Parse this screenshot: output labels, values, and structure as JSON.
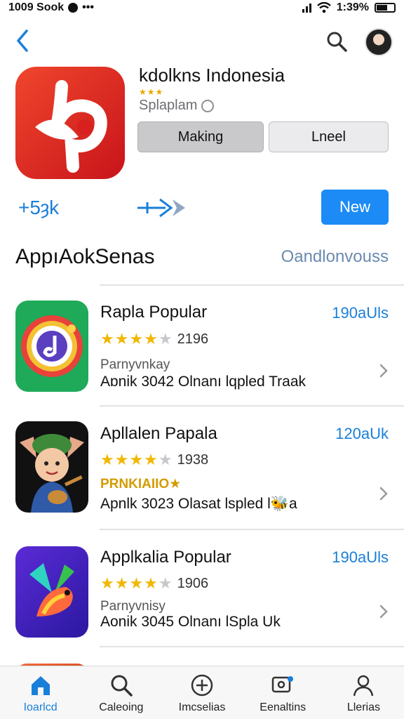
{
  "status": {
    "left_text": "1009 Sook",
    "right_text": "1:39%"
  },
  "app": {
    "title": "kdolkns Indonesia",
    "stars": "★★★",
    "subtitle": "Splaplam"
  },
  "buttons": {
    "making": "Making",
    "lneel": "Lneel",
    "new": "New"
  },
  "meta": {
    "left": "+5ȝk"
  },
  "section": {
    "title": "AppıAokSenas",
    "link": "Oandlonvouss"
  },
  "rows": [
    {
      "title": "Rapla Popular",
      "price": "190aUls",
      "rating_count": "2196",
      "stars_on": "★★★★",
      "star_off": "★",
      "sub": "Parnyvnkay",
      "detail": "Aɒnik 3042  Olnanı lqpled Traak"
    },
    {
      "title": "Apllalen Papala",
      "price": "120aUk",
      "rating_count": "1938",
      "stars_on": "★★★★",
      "star_off": "★",
      "sub": "PRNKIAIIO★",
      "detail": "Apnlk 3023  Olasat lspled l🐝a"
    },
    {
      "title": "Applkalia Popular",
      "price": "190aUls",
      "rating_count": "1906",
      "stars_on": "★★★★",
      "star_off": "★",
      "sub": "Parnyvnisy",
      "detail": "Aonik 3045  Olnanı lSpla Uk"
    }
  ],
  "tabs": [
    {
      "label": "Ioarlcd",
      "icon": "home-icon"
    },
    {
      "label": "Caleoing",
      "icon": "search-icon"
    },
    {
      "label": "Imcselias",
      "icon": "plus-icon"
    },
    {
      "label": "Eenaltins",
      "icon": "updates-icon"
    },
    {
      "label": "Llerias",
      "icon": "person-icon"
    }
  ],
  "colors": {
    "accent": "#1c8bf5",
    "star": "#f2b705",
    "app_icon": "#d8201f"
  }
}
